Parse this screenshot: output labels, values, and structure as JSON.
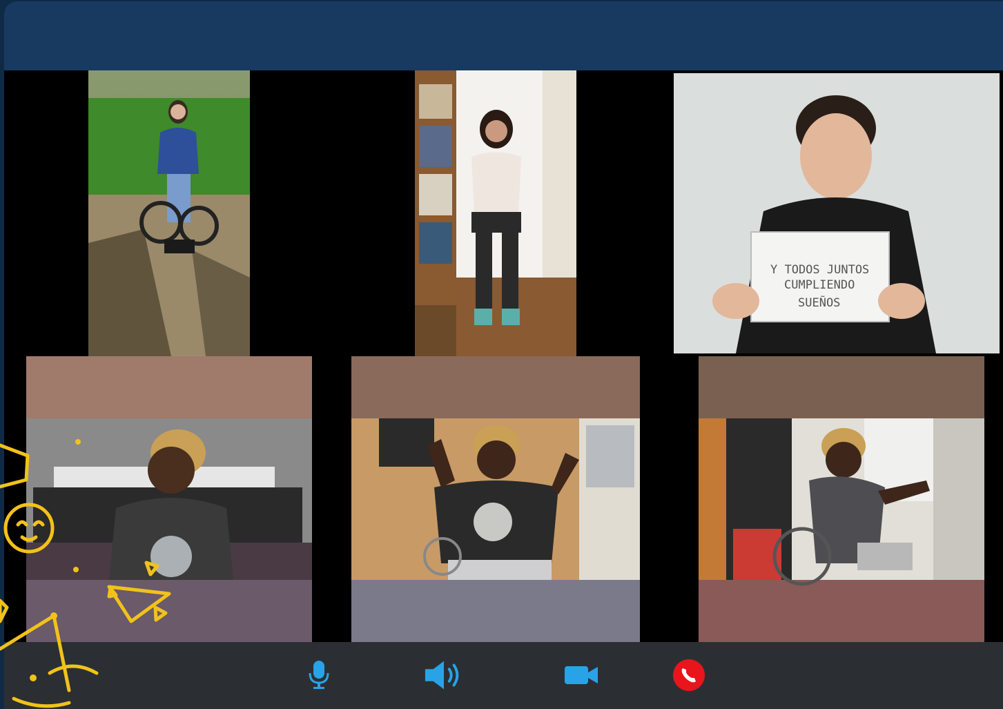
{
  "window": {
    "title_bar_color": "#183a60",
    "control_bar_color": "#2b2f33",
    "accent_color": "#29a3e8",
    "end_call_color": "#e8151d"
  },
  "participants": [
    {
      "id": "p1",
      "scene": "woman in wheelchair outdoors",
      "sign_text": null
    },
    {
      "id": "p2",
      "scene": "woman seated indoors by bookshelf",
      "sign_text": null
    },
    {
      "id": "p3",
      "scene": "young man holding handwritten sign",
      "sign_text": [
        "Y TODOS JUNTOS",
        "CUMPLIENDO",
        "SUEÑOS"
      ]
    },
    {
      "id": "p4",
      "scene": "man smiling on bed",
      "sign_text": null
    },
    {
      "id": "p5",
      "scene": "man flexing arms in wheelchair",
      "sign_text": null
    },
    {
      "id": "p6",
      "scene": "man in wheelchair waving",
      "sign_text": null
    }
  ],
  "controls": [
    {
      "name": "microphone-button",
      "icon": "microphone-icon"
    },
    {
      "name": "speaker-button",
      "icon": "speaker-icon"
    },
    {
      "name": "camera-button",
      "icon": "video-camera-icon"
    },
    {
      "name": "end-call-button",
      "icon": "end-call-icon"
    }
  ]
}
